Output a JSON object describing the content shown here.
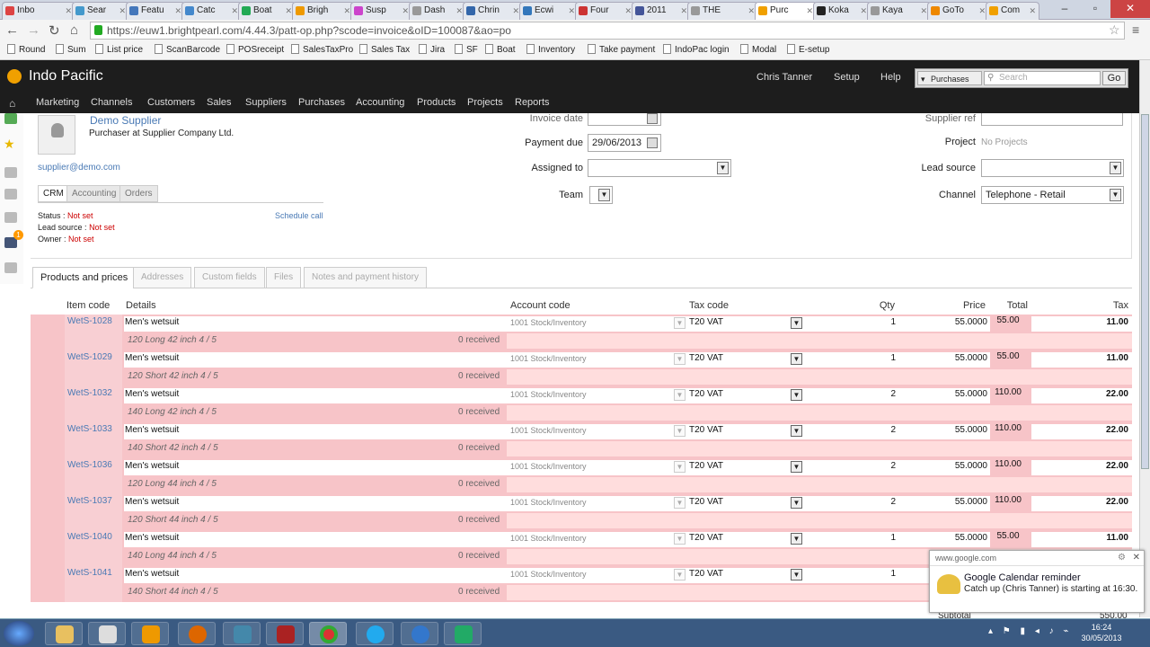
{
  "browser": {
    "tabs": [
      {
        "label": "Inbo",
        "color": "#d44"
      },
      {
        "label": "Sear",
        "color": "#49c"
      },
      {
        "label": "Featu",
        "color": "#47b"
      },
      {
        "label": "Catc",
        "color": "#48c"
      },
      {
        "label": "Boat",
        "color": "#2a5"
      },
      {
        "label": "Brigh",
        "color": "#e90"
      },
      {
        "label": "Susp",
        "color": "#c4c"
      },
      {
        "label": "Dash",
        "color": "#999"
      },
      {
        "label": "Chrin",
        "color": "#36a"
      },
      {
        "label": "Ecwi",
        "color": "#37b"
      },
      {
        "label": "Four",
        "color": "#c33"
      },
      {
        "label": "2011",
        "color": "#459"
      },
      {
        "label": "THE",
        "color": "#999"
      },
      {
        "label": "Purc",
        "color": "#f0a000"
      },
      {
        "label": "Koka",
        "color": "#222"
      },
      {
        "label": "Kaya",
        "color": "#999"
      },
      {
        "label": "GoTo",
        "color": "#e80"
      },
      {
        "label": "Com",
        "color": "#f0a000"
      }
    ],
    "url": "https://euw1.brightpearl.com/4.44.3/patt-op.php?scode=invoice&oID=100087&ao=po",
    "bookmarks": [
      "Round",
      "Sum",
      "List price",
      "ScanBarcode",
      "POSreceipt",
      "SalesTaxPro",
      "Sales Tax",
      "Jira",
      "SF",
      "Boat",
      "Inventory",
      "Take payment",
      "IndoPac login",
      "Modal",
      "E-setup"
    ]
  },
  "app": {
    "brand": "Indo Pacific",
    "user": "Chris Tanner",
    "setup": "Setup",
    "help": "Help",
    "search_scope": "Purchases",
    "search_placeholder": "Search",
    "go": "Go",
    "nav": [
      "Marketing",
      "Channels",
      "Customers",
      "Sales",
      "Suppliers",
      "Purchases",
      "Accounting",
      "Products",
      "Projects",
      "Reports"
    ],
    "notification_badge": "1"
  },
  "supplier": {
    "name": "Demo Supplier",
    "role_prefix": "Purchaser at",
    "company": "Supplier Company Ltd.",
    "email": "supplier@demo.com",
    "subtabs": [
      "CRM",
      "Accounting",
      "Orders"
    ],
    "status_label": "Status :",
    "status_value": "Not set",
    "lead_label": "Lead source :",
    "lead_value": "Not set",
    "owner_label": "Owner :",
    "owner_value": "Not set",
    "schedule": "Schedule call"
  },
  "form": {
    "invoice_date_label": "Invoice date",
    "payment_due_label": "Payment due",
    "payment_due_value": "29/06/2013",
    "assigned_label": "Assigned to",
    "team_label": "Team",
    "supplier_ref_label": "Supplier ref",
    "project_label": "Project",
    "project_value": "No Projects",
    "lead_source_label": "Lead source",
    "channel_label": "Channel",
    "channel_value": "Telephone - Retail"
  },
  "ptabs": [
    "Products and prices",
    "Addresses",
    "Custom fields",
    "Files",
    "Notes and payment history"
  ],
  "table": {
    "headers": [
      "Item code",
      "Details",
      "Account code",
      "Tax code",
      "Qty",
      "Price",
      "Total",
      "Tax"
    ],
    "rows": [
      {
        "code": "WetS-1028",
        "detail": "Men's wetsuit",
        "sub": "120 Long 42 inch 4 / 5",
        "received": "0 received",
        "account": "1001 Stock/Inventory",
        "tax": "T20 VAT",
        "qty": "1",
        "price": "55.0000",
        "total": "55.00",
        "taxamt": "11.00"
      },
      {
        "code": "WetS-1029",
        "detail": "Men's wetsuit",
        "sub": "120 Short 42 inch 4 / 5",
        "received": "0 received",
        "account": "1001 Stock/Inventory",
        "tax": "T20 VAT",
        "qty": "1",
        "price": "55.0000",
        "total": "55.00",
        "taxamt": "11.00"
      },
      {
        "code": "WetS-1032",
        "detail": "Men's wetsuit",
        "sub": "140 Long 42 inch 4 / 5",
        "received": "0 received",
        "account": "1001 Stock/Inventory",
        "tax": "T20 VAT",
        "qty": "2",
        "price": "55.0000",
        "total": "110.00",
        "taxamt": "22.00"
      },
      {
        "code": "WetS-1033",
        "detail": "Men's wetsuit",
        "sub": "140 Short 42 inch 4 / 5",
        "received": "0 received",
        "account": "1001 Stock/Inventory",
        "tax": "T20 VAT",
        "qty": "2",
        "price": "55.0000",
        "total": "110.00",
        "taxamt": "22.00"
      },
      {
        "code": "WetS-1036",
        "detail": "Men's wetsuit",
        "sub": "120 Long 44 inch 4 / 5",
        "received": "0 received",
        "account": "1001 Stock/Inventory",
        "tax": "T20 VAT",
        "qty": "2",
        "price": "55.0000",
        "total": "110.00",
        "taxamt": "22.00"
      },
      {
        "code": "WetS-1037",
        "detail": "Men's wetsuit",
        "sub": "120 Short 44 inch 4 / 5",
        "received": "0 received",
        "account": "1001 Stock/Inventory",
        "tax": "T20 VAT",
        "qty": "2",
        "price": "55.0000",
        "total": "110.00",
        "taxamt": "22.00"
      },
      {
        "code": "WetS-1040",
        "detail": "Men's wetsuit",
        "sub": "140 Long 44 inch 4 / 5",
        "received": "0 received",
        "account": "1001 Stock/Inventory",
        "tax": "T20 VAT",
        "qty": "1",
        "price": "55.0000",
        "total": "55.00",
        "taxamt": "11.00"
      },
      {
        "code": "WetS-1041",
        "detail": "Men's wetsuit",
        "sub": "140 Short 44 inch 4 / 5",
        "received": "0 received",
        "account": "1001 Stock/Inventory",
        "tax": "T20 VAT",
        "qty": "1",
        "price": "",
        "total": "",
        "taxamt": ""
      }
    ],
    "subtotal_label": "Subtotal",
    "subtotal_value": "550.00"
  },
  "notification": {
    "source": "www.google.com",
    "title": "Google Calendar reminder",
    "body": "Catch up (Chris Tanner) is starting at 16:30."
  },
  "clock": {
    "time": "16:24",
    "date": "30/05/2013"
  }
}
